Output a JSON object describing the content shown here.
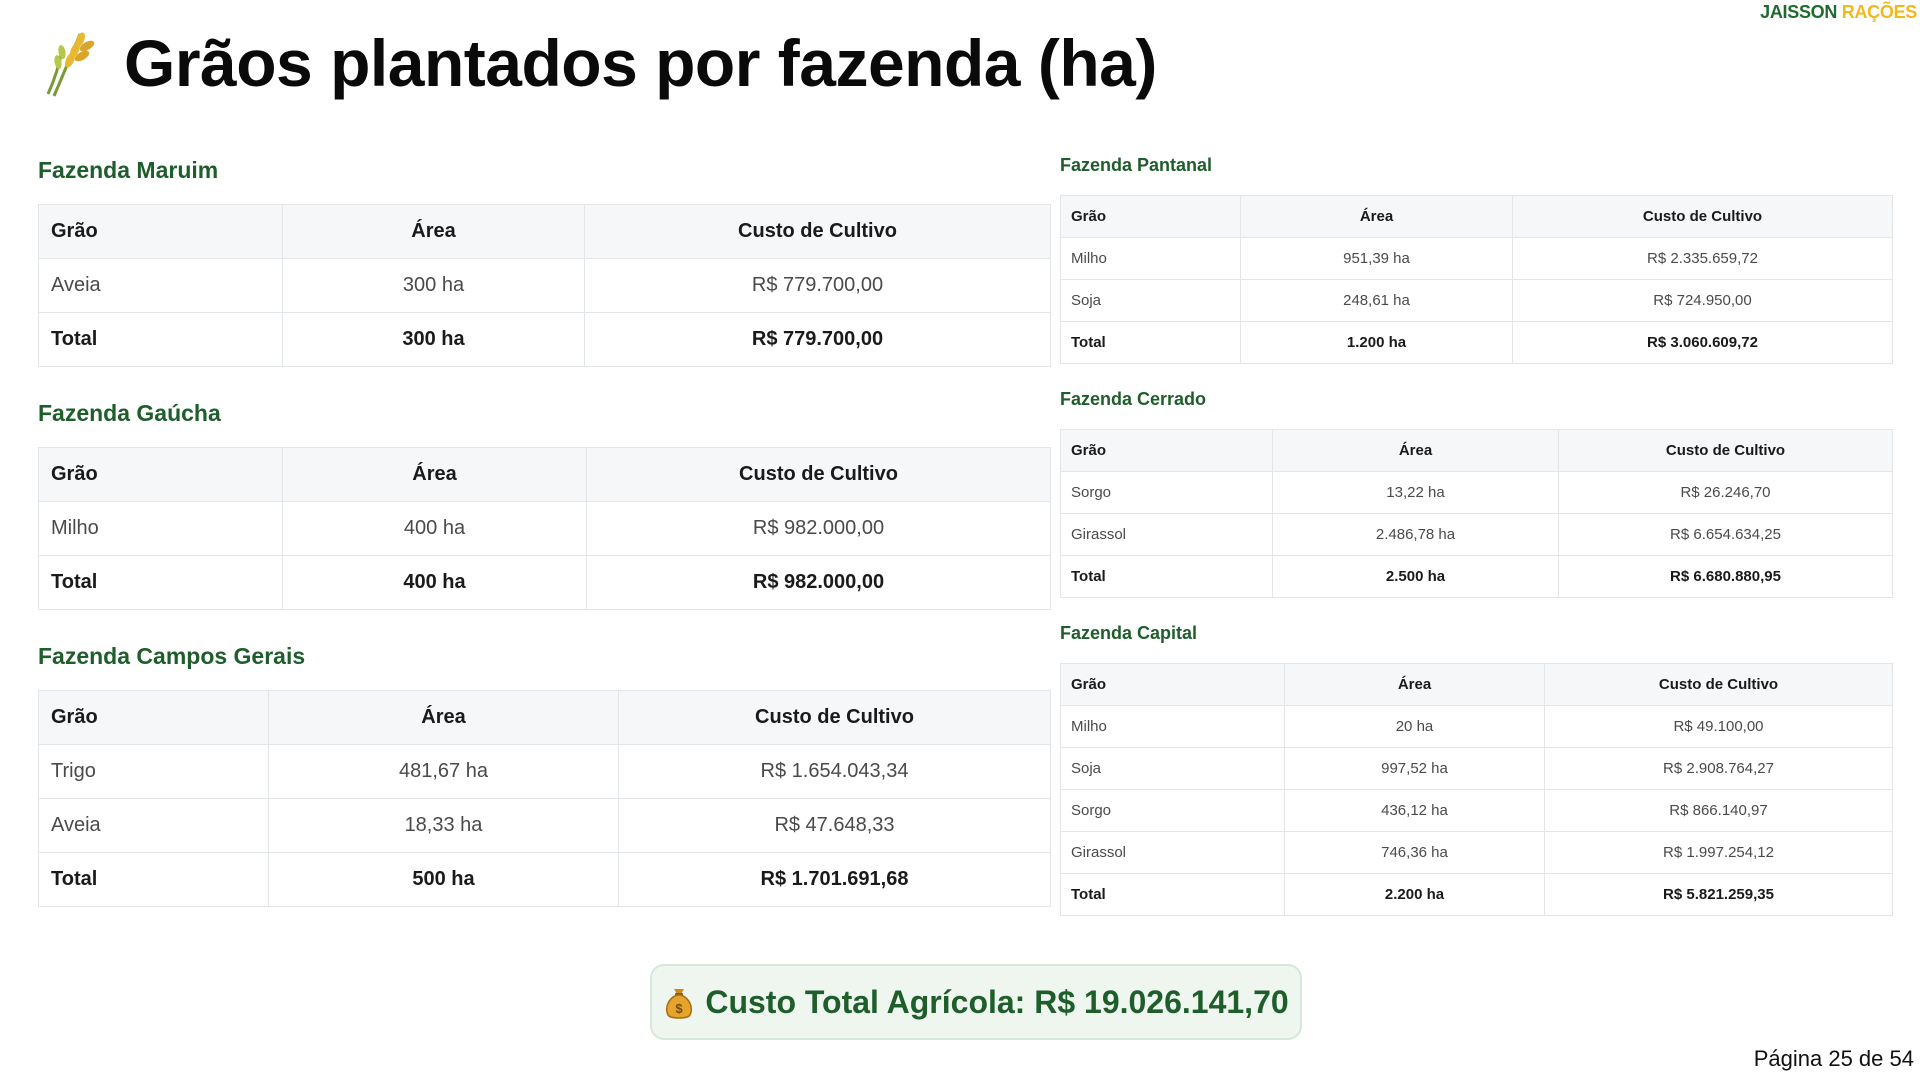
{
  "brand": {
    "part1": "JAISSON",
    "part2": "RAÇÕES"
  },
  "page_title": "Grãos plantados por fazenda (ha)",
  "left_farms": [
    {
      "name": "Fazenda Maruim",
      "headers": [
        "Grão",
        "Área",
        "Custo de Cultivo"
      ],
      "rows": [
        [
          "Aveia",
          "300 ha",
          "R$ 779.700,00"
        ]
      ],
      "total": [
        "Total",
        "300 ha",
        "R$ 779.700,00"
      ]
    },
    {
      "name": "Fazenda Gaúcha",
      "headers": [
        "Grão",
        "Área",
        "Custo de Cultivo"
      ],
      "rows": [
        [
          "Milho",
          "400 ha",
          "R$ 982.000,00"
        ]
      ],
      "total": [
        "Total",
        "400 ha",
        "R$ 982.000,00"
      ]
    },
    {
      "name": "Fazenda Campos Gerais",
      "headers": [
        "Grão",
        "Área",
        "Custo de Cultivo"
      ],
      "rows": [
        [
          "Trigo",
          "481,67 ha",
          "R$ 1.654.043,34"
        ],
        [
          "Aveia",
          "18,33 ha",
          "R$ 47.648,33"
        ]
      ],
      "total": [
        "Total",
        "500 ha",
        "R$ 1.701.691,68"
      ]
    }
  ],
  "right_farms": [
    {
      "name": "Fazenda Pantanal",
      "headers": [
        "Grão",
        "Área",
        "Custo de Cultivo"
      ],
      "rows": [
        [
          "Milho",
          "951,39 ha",
          "R$ 2.335.659,72"
        ],
        [
          "Soja",
          "248,61 ha",
          "R$ 724.950,00"
        ]
      ],
      "total": [
        "Total",
        "1.200 ha",
        "R$ 3.060.609,72"
      ]
    },
    {
      "name": "Fazenda Cerrado",
      "headers": [
        "Grão",
        "Área",
        "Custo de Cultivo"
      ],
      "rows": [
        [
          "Sorgo",
          "13,22 ha",
          "R$ 26.246,70"
        ],
        [
          "Girassol",
          "2.486,78 ha",
          "R$ 6.654.634,25"
        ]
      ],
      "total": [
        "Total",
        "2.500 ha",
        "R$ 6.680.880,95"
      ]
    },
    {
      "name": "Fazenda Capital",
      "headers": [
        "Grão",
        "Área",
        "Custo de Cultivo"
      ],
      "rows": [
        [
          "Milho",
          "20 ha",
          "R$ 49.100,00"
        ],
        [
          "Soja",
          "997,52 ha",
          "R$ 2.908.764,27"
        ],
        [
          "Sorgo",
          "436,12 ha",
          "R$ 866.140,97"
        ],
        [
          "Girassol",
          "746,36 ha",
          "R$ 1.997.254,12"
        ]
      ],
      "total": [
        "Total",
        "2.200 ha",
        "R$ 5.821.259,35"
      ]
    }
  ],
  "summary": "Custo Total Agrícola: R$ 19.026.141,70",
  "page_number": "Página 25 de 54",
  "icons": {
    "title": "sheaf-of-rice-icon",
    "summary": "money-bag-icon"
  },
  "colors": {
    "farm_title": "#1e5e2a",
    "brand_green": "#1e6b2d",
    "brand_yellow": "#f2b81c",
    "summary_bg": "#eef6ef"
  }
}
